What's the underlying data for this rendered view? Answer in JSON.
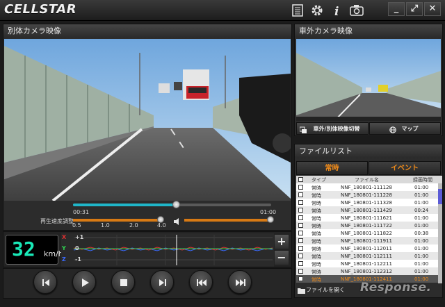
{
  "app": {
    "logo_text": "CELLSTAR",
    "window_buttons": [
      "_",
      "⤢",
      "✕"
    ],
    "toolbar_icons": [
      "list-icon",
      "gear-icon",
      "info-icon",
      "camera-icon"
    ]
  },
  "main_video": {
    "title": "別体カメラ映像"
  },
  "playback": {
    "time_current": "00:31",
    "time_total": "01:00",
    "progress": 0.52,
    "speed_label": "再生速度調整",
    "speed_ticks": [
      "0.5",
      "1.0",
      "2.0",
      "4.0"
    ],
    "speed_value": 4.0,
    "volume": 0.99
  },
  "speedometer": {
    "value": "32",
    "unit": "km/h"
  },
  "gsensor": {
    "axes": [
      {
        "name": "X",
        "color": "#e03030"
      },
      {
        "name": "Y",
        "color": "#2fd050"
      },
      {
        "name": "Z",
        "color": "#3a6aff"
      }
    ],
    "scale_labels": [
      "+1",
      "0",
      "-1"
    ],
    "zoom_in": "+",
    "zoom_out": "−"
  },
  "controls": [
    {
      "name": "skip-prev",
      "icon": "skip-prev-icon"
    },
    {
      "name": "play",
      "icon": "play-icon"
    },
    {
      "name": "stop",
      "icon": "stop-icon"
    },
    {
      "name": "step-forward",
      "icon": "step-forward-icon"
    },
    {
      "name": "rewind",
      "icon": "rewind-icon"
    },
    {
      "name": "fast-forward",
      "icon": "fast-forward-icon"
    }
  ],
  "outer_video": {
    "title": "車外カメラ映像",
    "switch_button": "車外/別体映像切替",
    "map_button": "マップ"
  },
  "file_list": {
    "title": "ファイルリスト",
    "tabs": [
      "常時",
      "イベント"
    ],
    "columns": [
      "タイプ",
      "ファイル名",
      "録画時間"
    ],
    "rows": [
      {
        "type": "常時",
        "file": "NNF_180801-111128",
        "time": "01:00"
      },
      {
        "type": "常時",
        "file": "NNF_180801-111228",
        "time": "01:00"
      },
      {
        "type": "常時",
        "file": "NNF_180801-111328",
        "time": "01:00"
      },
      {
        "type": "常時",
        "file": "NNF_180801-111429",
        "time": "00:24"
      },
      {
        "type": "常時",
        "file": "NNF_180801-111621",
        "time": "01:00"
      },
      {
        "type": "常時",
        "file": "NNF_180801-111722",
        "time": "01:00"
      },
      {
        "type": "常時",
        "file": "NNF_180801-111822",
        "time": "00:38"
      },
      {
        "type": "常時",
        "file": "NNF_180801-111911",
        "time": "01:00"
      },
      {
        "type": "常時",
        "file": "NNF_180801-112011",
        "time": "01:00"
      },
      {
        "type": "常時",
        "file": "NNF_180801-112111",
        "time": "01:00"
      },
      {
        "type": "常時",
        "file": "NNF_180801-112211",
        "time": "01:00"
      },
      {
        "type": "常時",
        "file": "NNF_180801-112312",
        "time": "01:00"
      },
      {
        "type": "常時",
        "file": "NNF_180801-112411",
        "time": "01:00",
        "selected": true
      }
    ],
    "open_button": "ファイルを開く"
  },
  "watermark": "Response."
}
